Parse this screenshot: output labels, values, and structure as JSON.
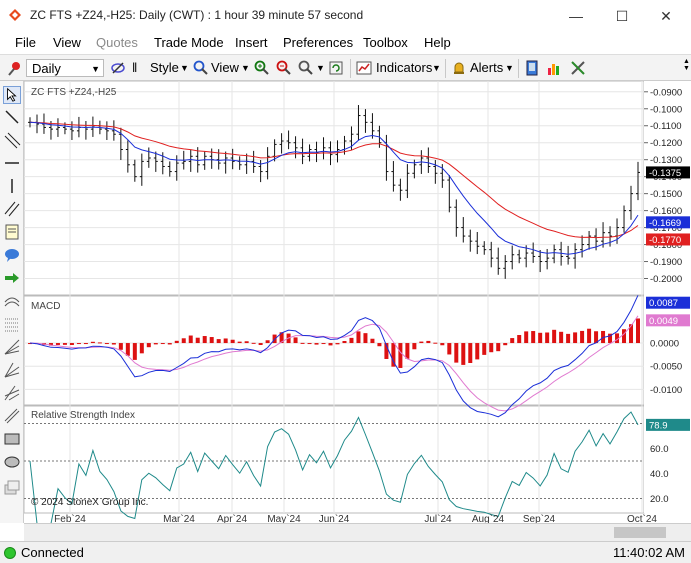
{
  "window": {
    "title": "ZC FTS +Z24,-H25: Daily (CWT) : 1 hour 39 minute 57 second"
  },
  "menu": [
    "File",
    "View",
    "Quotes",
    "Trade Mode",
    "Insert",
    "Preferences",
    "Toolbox",
    "Help"
  ],
  "toolbar": {
    "period": "Daily",
    "style_label": "Style",
    "view_label": "View",
    "indicators_label": "Indicators",
    "alerts_label": "Alerts"
  },
  "panels": {
    "price_title": "ZC FTS +Z24,-H25",
    "macd_title": "MACD",
    "rsi_title": "Relative Strength Index",
    "copyright": "© 2024 StoneX Group Inc."
  },
  "price_axis": [
    "-0.0900",
    "-0.1000",
    "-0.1100",
    "-0.1200",
    "-0.1300",
    "-0.1400",
    "-0.1500",
    "-0.1600",
    "-0.1700",
    "-0.1800",
    "-0.1900",
    "-0.2000"
  ],
  "price_tags": {
    "last": "-0.1375",
    "ma_blue": "-0.1669",
    "ma_red": "-0.1770",
    "last_color": "#000000",
    "blue_color": "#1b2fd8",
    "red_color": "#e02020"
  },
  "macd_axis": [
    "0.0000",
    "-0.0050",
    "-0.0100"
  ],
  "macd_tags": {
    "macd": "0.0087",
    "signal": "0.0049",
    "macd_color": "#1b2fd8",
    "signal_color": "#e07ad0"
  },
  "rsi_axis": [
    "60.0",
    "40.0",
    "20.0"
  ],
  "rsi_tag": "78.9",
  "rsi_color": "#1f8a8a",
  "x_labels": [
    "Feb`24",
    "Mar`24",
    "Apr`24",
    "May`24",
    "Jun`24",
    "Jul`24",
    "Aug`24",
    "Sep`24",
    "Oct`24"
  ],
  "status": {
    "connection": "Connected",
    "time": "11:40:02 AM"
  },
  "chart_data": {
    "type": "line",
    "title": "ZC FTS +Z24,-H25",
    "x_ticks": [
      "Feb`24",
      "Mar`24",
      "Apr`24",
      "May`24",
      "Jun`24",
      "Jul`24",
      "Aug`24",
      "Sep`24",
      "Oct`24"
    ],
    "price": {
      "ylim": [
        -0.205,
        -0.086
      ],
      "closes": [
        -0.108,
        -0.109,
        -0.111,
        -0.112,
        -0.111,
        -0.112,
        -0.113,
        -0.111,
        -0.112,
        -0.11,
        -0.112,
        -0.113,
        -0.115,
        -0.124,
        -0.133,
        -0.14,
        -0.131,
        -0.129,
        -0.131,
        -0.134,
        -0.137,
        -0.132,
        -0.131,
        -0.128,
        -0.133,
        -0.128,
        -0.13,
        -0.132,
        -0.129,
        -0.131,
        -0.133,
        -0.131,
        -0.134,
        -0.137,
        -0.128,
        -0.121,
        -0.119,
        -0.12,
        -0.123,
        -0.128,
        -0.124,
        -0.126,
        -0.123,
        -0.127,
        -0.124,
        -0.119,
        -0.115,
        -0.104,
        -0.108,
        -0.113,
        -0.12,
        -0.137,
        -0.145,
        -0.148,
        -0.138,
        -0.133,
        -0.129,
        -0.134,
        -0.138,
        -0.142,
        -0.158,
        -0.17,
        -0.175,
        -0.178,
        -0.181,
        -0.183,
        -0.188,
        -0.194,
        -0.19,
        -0.186,
        -0.188,
        -0.185,
        -0.187,
        -0.19,
        -0.188,
        -0.183,
        -0.187,
        -0.188,
        -0.183,
        -0.18,
        -0.175,
        -0.178,
        -0.173,
        -0.175,
        -0.17,
        -0.16,
        -0.15,
        -0.1375
      ],
      "ma_fast_last": -0.1669,
      "ma_slow_last": -0.177,
      "last": -0.1375
    },
    "macd": {
      "ylim": [
        -0.0125,
        0.0095
      ],
      "macd_last": 0.0087,
      "signal_last": 0.0049
    },
    "rsi": {
      "ylim": [
        10,
        90
      ],
      "levels": [
        80,
        50,
        20
      ],
      "last": 78.9
    }
  }
}
